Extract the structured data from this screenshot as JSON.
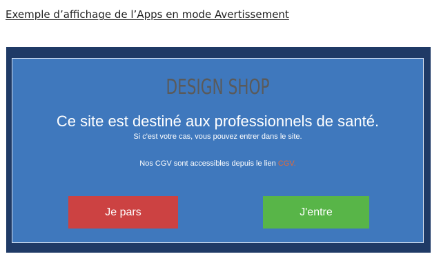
{
  "caption": "Exemple d’affichage de l’Apps en mode Avertissement",
  "modal": {
    "brand": "DESIGN SHOP",
    "headline": "Ce site est destiné aux professionnels de santé.",
    "subline": "Si c'est votre cas, vous pouvez entrer dans le site.",
    "cgv_text": "Nos CGV sont accessibles depuis le lien ",
    "cgv_link": "CGV.",
    "leave_button": "Je pars",
    "enter_button": "J'entre"
  },
  "colors": {
    "frame": "#1f3a66",
    "panel": "#3f78bd",
    "leave": "#cc4242",
    "enter": "#58b548",
    "link": "#e2693b"
  }
}
